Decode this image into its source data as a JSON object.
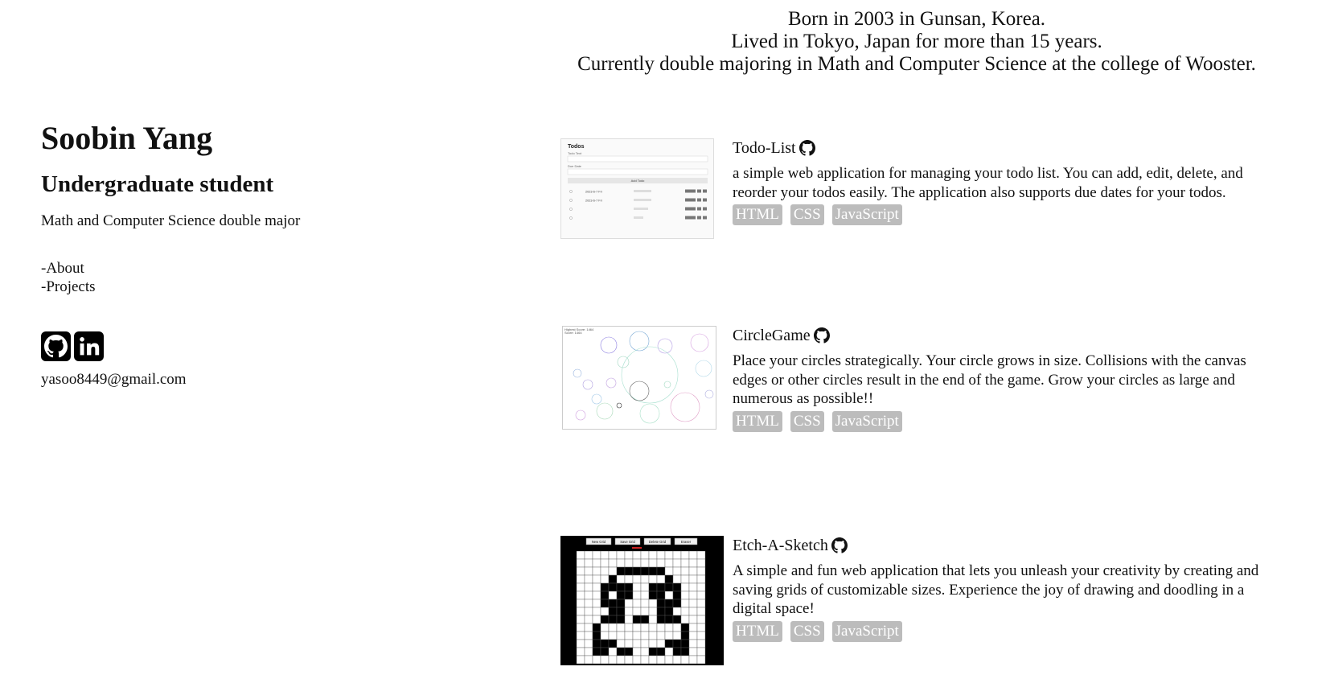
{
  "about": {
    "lines": [
      "Born in 2003 in Gunsan, Korea.",
      "Lived in Tokyo, Japan for more than 15 years.",
      "Currently double majoring in Math and Computer Science at the college of Wooster."
    ]
  },
  "profile": {
    "name": "Soobin Yang",
    "role": "Undergraduate student",
    "major": "Math and Computer Science double major",
    "email": "yasoo8449@gmail.com"
  },
  "nav": {
    "about": "-About",
    "projects": "-Projects"
  },
  "social": {
    "icons": [
      "github-icon",
      "linkedin-icon"
    ]
  },
  "projects": [
    {
      "title": "Todo-List",
      "description": "a simple web application for managing your todo list. You can add, edit, delete, and reorder your todos easily. The application also supports due dates for your todos.",
      "tags": [
        "HTML",
        "CSS",
        "JavaScript"
      ],
      "screenshot": {
        "heading": "Todos",
        "field1": "Todo Text",
        "field2": "Due Date",
        "button": "Add Todo",
        "rows": [
          "2023-6-7 Fri",
          "2023-6-7 Fri",
          "",
          ""
        ]
      }
    },
    {
      "title": "CircleGame",
      "description": "Place your circles strategically. Your circle grows in size. Collisions with the canvas edges or other circles result in the end of the game. Grow your circles as large and numerous as possible!!",
      "tags": [
        "HTML",
        "CSS",
        "JavaScript"
      ],
      "screenshot": {
        "line1": "Highest Score: 1464",
        "line2": "Score: 1464"
      }
    },
    {
      "title": "Etch-A-Sketch",
      "description": "A simple and fun web application that lets you unleash your creativity by creating and saving grids of customizable sizes. Experience the joy of drawing and doodling in a digital space!",
      "tags": [
        "HTML",
        "CSS",
        "JavaScript"
      ],
      "screenshot": {
        "buttons": [
          "New Grid",
          "Save Grid",
          "Delete Grid",
          "Eraser"
        ]
      }
    }
  ],
  "colors": {
    "tag_bg": "#bcbcbc",
    "text": "#111111"
  }
}
